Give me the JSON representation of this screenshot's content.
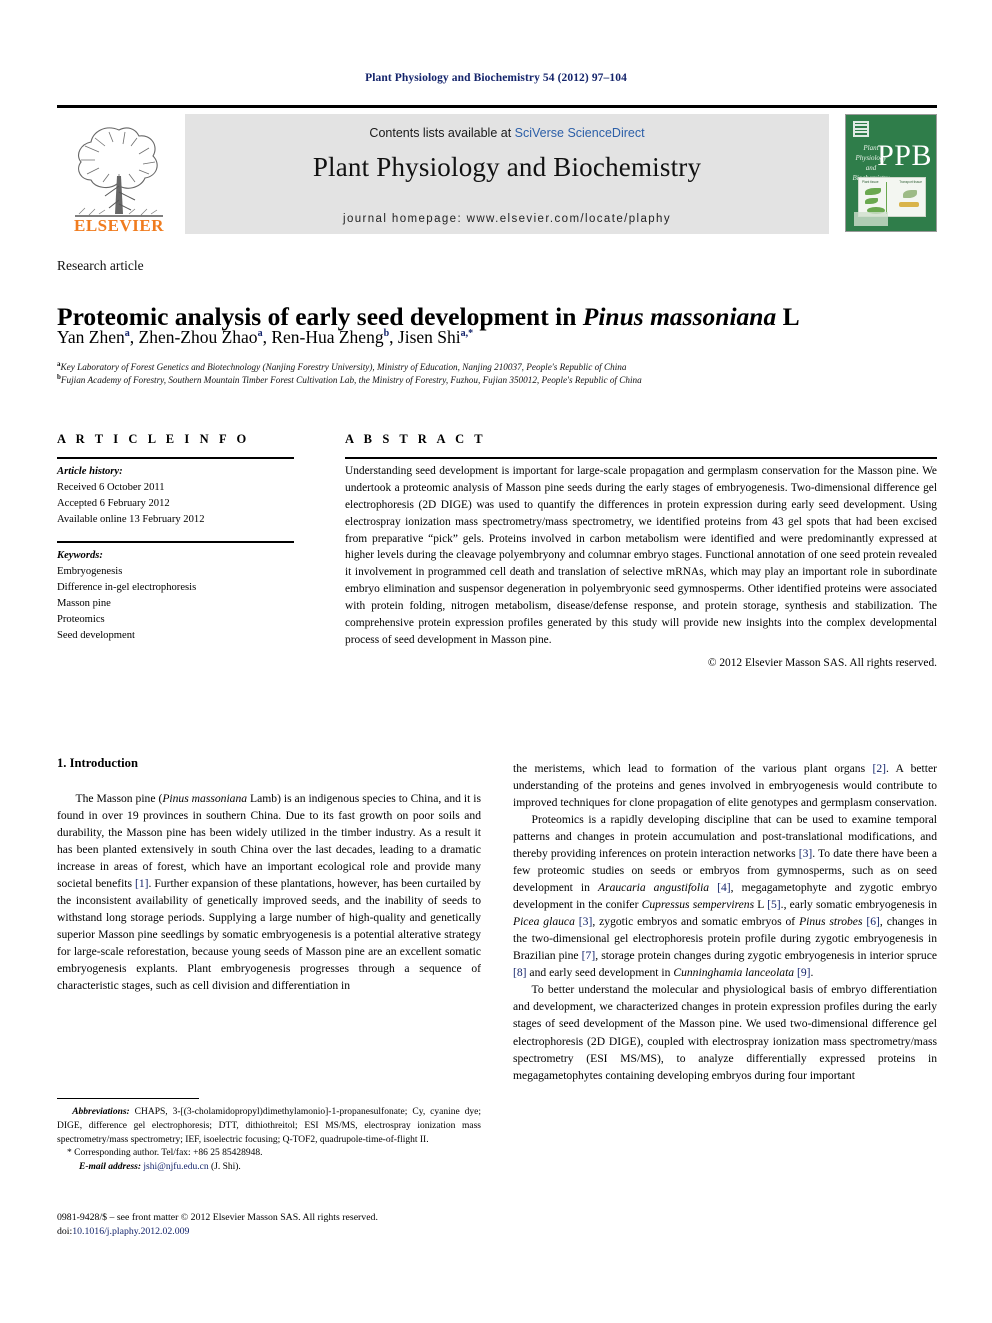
{
  "running_head": "Plant Physiology and Biochemistry 54 (2012) 97–104",
  "masthead": {
    "contents_prefix": "Contents lists available at ",
    "contents_link": "SciVerse ScienceDirect",
    "journal_title": "Plant Physiology and Biochemistry",
    "homepage": "journal homepage: www.elsevier.com/locate/plaphy",
    "publisher_logo_text": "ELSEVIER",
    "cover": {
      "letters": "PPB",
      "journal_lines": "Plant\nPhysiology\nand\nBiochemistry",
      "fig_left_label": "Plant tissue",
      "fig_right_label": "Transport tissue",
      "color": "#2f7d4a"
    }
  },
  "article": {
    "type": "Research article",
    "title_pre": "Proteomic analysis of early seed development in ",
    "title_italic": "Pinus massoniana",
    "title_post": " L",
    "authors": [
      {
        "name": "Yan Zhen",
        "sup": "a",
        "sep": ", "
      },
      {
        "name": "Zhen-Zhou Zhao",
        "sup": "a",
        "sep": ", "
      },
      {
        "name": "Ren-Hua Zheng",
        "sup": "b",
        "sep": ", "
      },
      {
        "name": "Jisen Shi",
        "sup": "a,*",
        "sep": ""
      }
    ],
    "affiliations": [
      {
        "marker": "a",
        "text": "Key Laboratory of Forest Genetics and Biotechnology (Nanjing Forestry University), Ministry of Education, Nanjing 210037, People's Republic of China"
      },
      {
        "marker": "b",
        "text": "Fujian Academy of Forestry, Southern Mountain Timber Forest Cultivation Lab, the Ministry of Forestry, Fuzhou, Fujian 350012, People's Republic of China"
      }
    ]
  },
  "info": {
    "heading": "A R T I C L E   I N F O",
    "history_label": "Article history:",
    "history": [
      "Received 6 October 2011",
      "Accepted 6 February 2012",
      "Available online 13 February 2012"
    ],
    "keywords_label": "Keywords:",
    "keywords": [
      "Embryogenesis",
      "Difference in-gel electrophoresis",
      "Masson pine",
      "Proteomics",
      "Seed development"
    ]
  },
  "abstract": {
    "heading": "A B S T R A C T",
    "text": "Understanding seed development is important for large-scale propagation and germplasm conservation for the Masson pine. We undertook a proteomic analysis of Masson pine seeds during the early stages of embryogenesis. Two-dimensional difference gel electrophoresis (2D DIGE) was used to quantify the differences in protein expression during early seed development. Using electrospray ionization mass spectrometry/mass spectrometry, we identified proteins from 43 gel spots that had been excised from preparative “pick” gels. Proteins involved in carbon metabolism were identified and were predominantly expressed at higher levels during the cleavage polyembryony and columnar embryo stages. Functional annotation of one seed protein revealed it involvement in programmed cell death and translation of selective mRNAs, which may play an important role in subordinate embryo elimination and suspensor degeneration in polyembryonic seed gymnosperms. Other identified proteins were associated with protein folding, nitrogen metabolism, disease/defense response, and protein storage, synthesis and stabilization. The comprehensive protein expression profiles generated by this study will provide new insights into the complex developmental process of seed development in Masson pine.",
    "copyright": "© 2012 Elsevier Masson SAS. All rights reserved."
  },
  "body": {
    "section_title": "1. Introduction",
    "left_paragraphs": [
      "The Masson pine (<i>Pinus massoniana</i> Lamb) is an indigenous species to China, and it is found in over 19 provinces in southern China. Due to its fast growth on poor soils and durability, the Masson pine has been widely utilized in the timber industry. As a result it has been planted extensively in south China over the last decades, leading to a dramatic increase in areas of forest, which have an important ecological role and provide many societal benefits <span class=\"ref\">[1]</span>. Further expansion of these plantations, however, has been curtailed by the inconsistent availability of genetically improved seeds, and the inability of seeds to withstand long storage periods. Supplying a large number of high-quality and genetically superior Masson pine seedlings by somatic embryogenesis is a potential alterative strategy for large-scale reforestation, because young seeds of Masson pine are an excellent somatic embryogenesis explants. Plant embryogenesis progresses through a sequence of characteristic stages, such as cell division and differentiation in"
    ],
    "right_paragraphs": [
      "the meristems, which lead to formation of the various plant organs <span class=\"ref\">[2]</span>. A better understanding of the proteins and genes involved in embryogenesis would contribute to improved techniques for clone propagation of elite genotypes and germplasm conservation.",
      "Proteomics is a rapidly developing discipline that can be used to examine temporal patterns and changes in protein accumulation and post-translational modifications, and thereby providing inferences on protein interaction networks <span class=\"ref\">[3]</span>. To date there have been a few proteomic studies on seeds or embryos from gymnosperms, such as on seed development in <i>Araucaria angustifolia</i> <span class=\"ref\">[4]</span>, megagametophyte and zygotic embryo development in the conifer <i>Cupressus sempervirens</i> L <span class=\"ref\">[5]</span>., early somatic embryogenesis in <i>Picea glauca</i> <span class=\"ref\">[3]</span>, zygotic embryos and somatic embryos of <i>Pinus strobes</i> <span class=\"ref\">[6]</span>, changes in the two-dimensional gel electrophoresis protein profile during zygotic embryogenesis in Brazilian pine <span class=\"ref\">[7]</span>, storage protein changes during zygotic embryogenesis in interior spruce <span class=\"ref\">[8]</span> and early seed development in <i>Cunninghamia lanceolata</i> <span class=\"ref\">[9]</span>.",
      "To better understand the molecular and physiological basis of embryo differentiation and development, we characterized changes in protein expression profiles during the early stages of seed development of the Masson pine. We used two-dimensional difference gel electrophoresis (2D DIGE), coupled with electrospray ionization mass spectrometry/mass spectrometry (ESI MS/MS), to analyze differentially expressed proteins in megagametophytes containing developing embryos during four important"
    ]
  },
  "footnotes": {
    "abbreviations_label": "Abbreviations:",
    "abbreviations_text": "CHAPS, 3-[(3-cholamidopropyl)dimethylamonio]-1-propanesulfonate; Cy, cyanine dye; DIGE, difference gel electrophoresis; DTT, dithiothreitol; ESI MS/MS, electrospray ionization mass spectrometry/mass spectrometry; IEF, isoelectric focusing; Q-TOF2, quadrupole-time-of-flight II.",
    "corresponding": "* Corresponding author. Tel/fax: +86 25 85428948.",
    "email_label": "E-mail address:",
    "email": "jshi@njfu.edu.cn",
    "email_suffix": " (J. Shi)."
  },
  "imprint": {
    "line1_pre": "0981-9428/$ – see front matter © 2012 Elsevier Masson SAS. All rights reserved.",
    "doi_label": "doi:",
    "doi": "10.1016/j.plaphy.2012.02.009"
  }
}
